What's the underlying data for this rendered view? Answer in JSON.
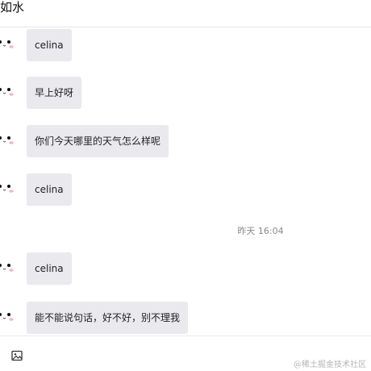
{
  "header": {
    "title": "如水"
  },
  "messages": [
    {
      "text": "celina"
    },
    {
      "text": "早上好呀"
    },
    {
      "text": "你们今天哪里的天气怎么样呢"
    },
    {
      "text": "celina"
    },
    {
      "text": "celina"
    },
    {
      "text": "能不能说句话，好不好，别不理我"
    }
  ],
  "timestamp": "昨天 16:04",
  "toolbar": {
    "icon": "image-icon"
  },
  "watermark": "@稀土掘金技术社区"
}
